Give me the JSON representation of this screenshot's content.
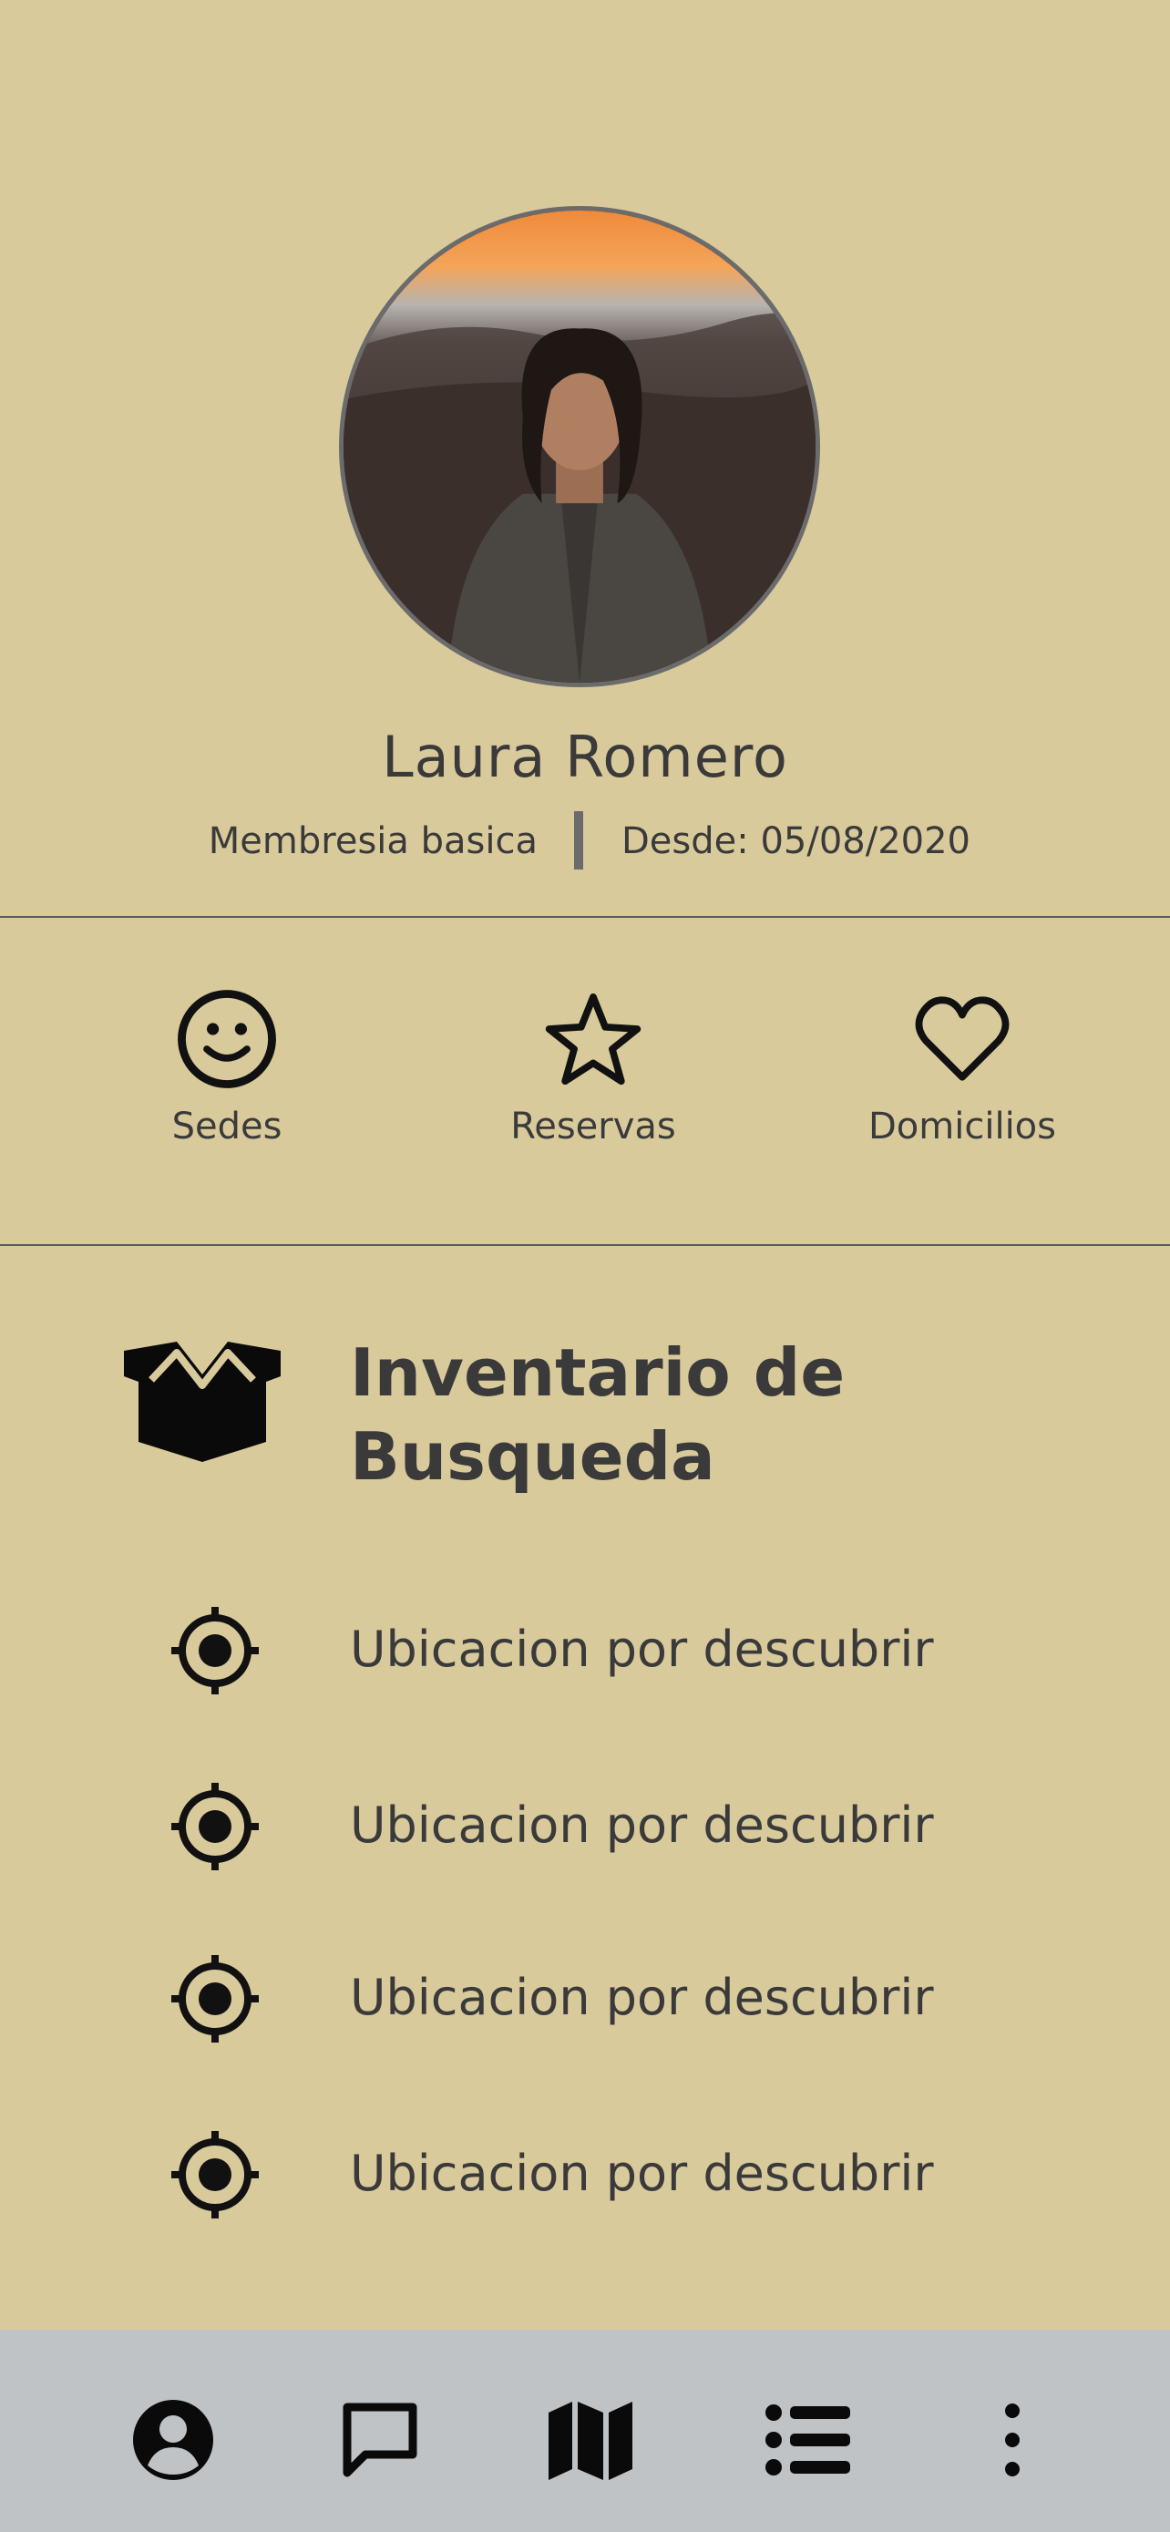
{
  "profile": {
    "name": "Laura Romero",
    "membership": "Membresia basica",
    "since": "Desde: 05/08/2020",
    "avatar_icon": "profile-photo"
  },
  "quick_actions": [
    {
      "label": "Sedes",
      "icon": "smiley-icon"
    },
    {
      "label": "Reservas",
      "icon": "star-icon"
    },
    {
      "label": "Domicilios",
      "icon": "heart-icon"
    }
  ],
  "inventory": {
    "title": "Inventario de Busqueda",
    "icon": "open-box-icon",
    "items": [
      {
        "label": "Ubicacion por descubrir",
        "icon": "crosshair-icon"
      },
      {
        "label": "Ubicacion por descubrir",
        "icon": "crosshair-icon"
      },
      {
        "label": "Ubicacion por descubrir",
        "icon": "crosshair-icon"
      },
      {
        "label": "Ubicacion por descubrir",
        "icon": "crosshair-icon"
      }
    ]
  },
  "bottom_nav": [
    {
      "icon": "user-circle-icon"
    },
    {
      "icon": "chat-bubble-icon"
    },
    {
      "icon": "map-icon"
    },
    {
      "icon": "list-icon"
    },
    {
      "icon": "more-vertical-icon"
    }
  ],
  "colors": {
    "background": "#D9CA9C",
    "text": "#3a3a3a",
    "nav_background": "#BFC3C6",
    "divider": "#5a5a5a"
  }
}
